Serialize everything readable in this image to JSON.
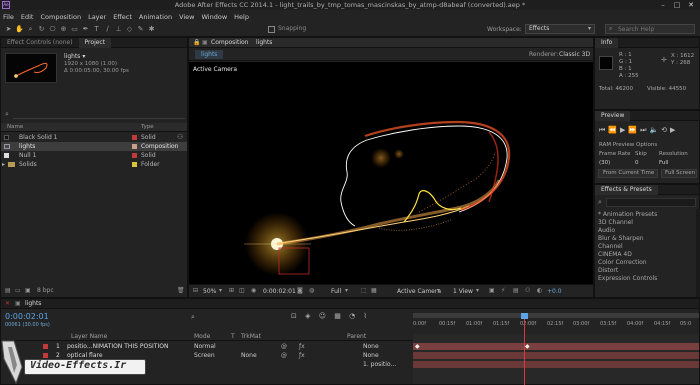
{
  "app": {
    "title": "Adobe After Effects CC 2014.1 - light_trails_by_tmp_tomas_mascinskas_by_atmp-d8abeaf (converted).aep *",
    "icon": "Ae"
  },
  "menu": [
    "File",
    "Edit",
    "Composition",
    "Layer",
    "Effect",
    "Animation",
    "View",
    "Window",
    "Help"
  ],
  "toolbar": {
    "snapping_label": "Snapping",
    "workspace_label": "Workspace:",
    "workspace_value": "Effects",
    "search_placeholder": "Search Help"
  },
  "project_panel": {
    "tab_effect_controls": "Effect Controls (none)",
    "tab_project": "Project",
    "selected_name": "lights ▾",
    "selected_info1": "1920 x 1080 (1.00)",
    "selected_info2": "Δ 0:00:05:00, 30.00 fps",
    "col_name": "Name",
    "col_type": "Type",
    "items": [
      {
        "name": "Black Solid 1",
        "type": "Solid",
        "color": "#c23a3a"
      },
      {
        "name": "lights",
        "type": "Composition",
        "color": "#c8a088"
      },
      {
        "name": "Null 1",
        "type": "Solid",
        "color": "#c23a3a"
      },
      {
        "name": "Solids",
        "type": "Folder",
        "color": "#d8c53a"
      }
    ],
    "bpc": "8 bpc"
  },
  "comp_panel": {
    "tab_label": "Composition",
    "tab_name": "lights",
    "subtab": "lights",
    "renderer_label": "Renderer:",
    "renderer_value": "Classic 3D",
    "camera_label": "Active Camera",
    "zoom": "50%",
    "timecode": "0:00:02:01",
    "resolution": "Full",
    "camera_select": "Active Camera",
    "views": "1 View",
    "exposure": "+0.0"
  },
  "info_panel": {
    "tab": "Info",
    "r": "R : 1",
    "g": "G : 1",
    "b": "B : 1",
    "a": "A : 255",
    "x": "X : 1612",
    "y": "Y : 268",
    "total": "Total: 46200",
    "visible": "Visible: 44550"
  },
  "preview_panel": {
    "tab": "Preview",
    "ram_options": "RAM Preview Options",
    "frame_rate_label": "Frame Rate",
    "skip_label": "Skip",
    "resolution_label": "Resolution",
    "frame_rate_value": "(30)",
    "skip_value": "0",
    "resolution_value": "Full",
    "from_current": "From Current Time",
    "full_screen": "Full Screen"
  },
  "effects_panel": {
    "tab": "Effects & Presets",
    "search_placeholder": "",
    "items": [
      "* Animation Presets",
      "3D Channel",
      "Audio",
      "Blur & Sharpen",
      "Channel",
      "CINEMA 4D",
      "Color Correction",
      "Distort",
      "Expression Controls"
    ]
  },
  "timeline": {
    "tab": "lights",
    "timecode": "0:00:02:01",
    "frame_info": "00061 (30.00 fps)",
    "col_layer_name": "Layer Name",
    "col_mode": "Mode",
    "col_t": "T",
    "col_trkmat": "TrkMat",
    "col_parent": "Parent",
    "ruler": [
      "0:00f",
      "00:15f",
      "01:00f",
      "01:15f",
      "02:00f",
      "02:15f",
      "03:00f",
      "03:15f",
      "04:00f",
      "04:15f",
      "05:0"
    ],
    "layers": [
      {
        "num": "1",
        "name": "positio...NIMATION THIS POSITION",
        "mode": "Normal",
        "trkmat": "",
        "parent": "None",
        "color": "#c23a3a"
      },
      {
        "num": "2",
        "name": "optical flare",
        "mode": "Screen",
        "trkmat": "None",
        "parent": "None",
        "color": "#c23a3a"
      },
      {
        "num": "3",
        "name": "",
        "mode": "",
        "trkmat": "",
        "parent": "1. positio...",
        "color": "#c23a3a"
      }
    ]
  },
  "watermark": {
    "text": "Video-Effects.Ir"
  }
}
